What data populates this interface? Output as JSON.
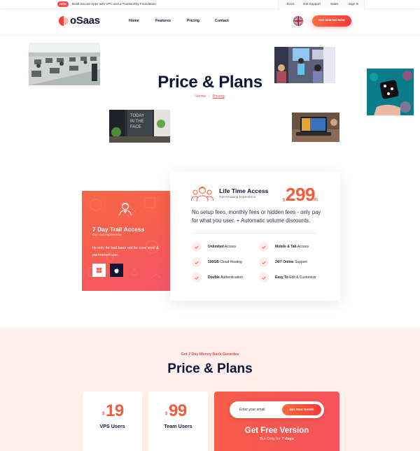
{
  "topbar": {
    "badge": "NEW",
    "notice": "Build Secure Apps with VPC and a Trustworthy Foundation",
    "links": [
      "Docs",
      "Get Support",
      "Sales",
      "Sign In"
    ]
  },
  "header": {
    "logo": "oSaas",
    "nav": [
      "Home",
      "Features",
      "Pricing",
      "Contact"
    ],
    "language_icon": "uk-flag-icon",
    "cta": "Get Started Now"
  },
  "hero": {
    "title": "Price & Plans",
    "breadcrumb": {
      "home": "Home",
      "separator": "|",
      "current": "Pricing"
    },
    "photos": [
      "office-workspace",
      "team-presentation",
      "dice-hand",
      "cafe-chalkboard",
      "desk-laptop"
    ]
  },
  "trial": {
    "title": "7 Day Trail Access",
    "subtitle": "Get trail experience",
    "description": "Its only for trail base not for core level & parmanent use.",
    "buttons": [
      "windows-icon",
      "apple-icon"
    ]
  },
  "lifetime": {
    "title": "Life Time Access",
    "subtitle": "Get Amazing experience",
    "currency": "$",
    "price": "299",
    "cents": ".00",
    "description": "No setup fees, monthly fees or hidden fees - only pay for what you user. + Automatic volume discounts.",
    "features": [
      {
        "bold": "Unlimited",
        "text": " Access"
      },
      {
        "bold": "Mobile & Tab",
        "text": " Access"
      },
      {
        "bold": "100GB",
        "text": " Cloud Hosting"
      },
      {
        "bold": "24/7 Online",
        "text": " Support"
      },
      {
        "bold": "Double",
        "text": " Authentication"
      },
      {
        "bold": "Easy To",
        "text": " Edit & Customize"
      }
    ]
  },
  "plans_section": {
    "kicker": "Get 7 Day Money Back Gurantee",
    "title": "Price & Plans",
    "plans": [
      {
        "currency": "$",
        "price": "19",
        "name": "VPS Users"
      },
      {
        "currency": "$",
        "price": "99",
        "name": "Team Users"
      }
    ],
    "free": {
      "email_placeholder": "Enter your email",
      "button": "Get Your Goods",
      "title": "Get Free Version",
      "sub_prefix": "But Only for ",
      "sub_bold": "7 days"
    }
  },
  "colors": {
    "accent": "#f65b3b",
    "navy": "#0f1839",
    "band": "#fff0ee"
  }
}
